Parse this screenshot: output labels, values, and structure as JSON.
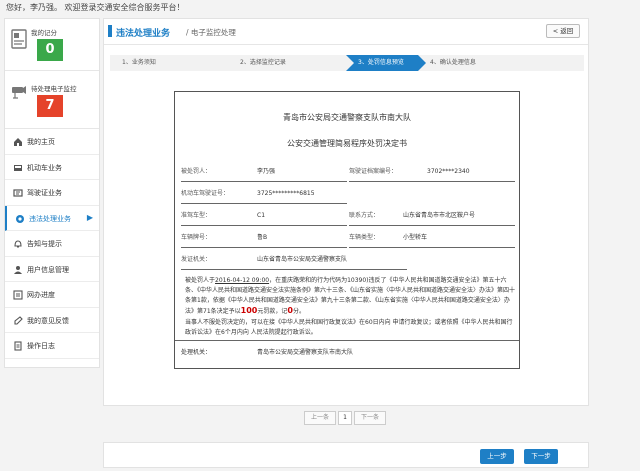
{
  "greeting": "您好，李乃强。 欢迎登录交通安全综合服务平台！",
  "sidebar": {
    "cards": [
      {
        "label": "我的记分",
        "count": "0",
        "color": "#3aa84a"
      },
      {
        "label": "待处理电子监控",
        "count": "7",
        "color": "#e5432a"
      }
    ],
    "items": [
      {
        "label": "我的主页",
        "icon": "home-icon"
      },
      {
        "label": "机动车业务",
        "icon": "car-icon"
      },
      {
        "label": "驾驶证业务",
        "icon": "license-icon"
      },
      {
        "label": "违法处理业务",
        "icon": "camera-icon",
        "active": true
      },
      {
        "label": "告知与提示",
        "icon": "bell-icon"
      },
      {
        "label": "用户信息管理",
        "icon": "user-icon"
      },
      {
        "label": "网办进度",
        "icon": "progress-icon"
      },
      {
        "label": "我的意见反馈",
        "icon": "feedback-icon"
      },
      {
        "label": "操作日志",
        "icon": "log-icon"
      }
    ]
  },
  "header": {
    "title": "违法处理业务",
    "subtitle": "/ 电子监控处理",
    "back_label": "< 返回"
  },
  "steps": [
    {
      "label": "1、业务须知"
    },
    {
      "label": "2、选择监控记录"
    },
    {
      "label": "3、处罚信息预览",
      "active": true
    },
    {
      "label": "4、确认处理信息"
    }
  ],
  "doc": {
    "org": "青岛市公安局交通警察支队市南大队",
    "title": "公安交通管理简易程序处罚决定书",
    "fields": {
      "name_k": "被处罚人：",
      "name_v": "李乃强",
      "lic_k": "驾驶证档案编号：",
      "lic_v": "3702****2340",
      "dl_k": "机动车驾驶证号：",
      "dl_v": "3725*********6815",
      "type_k": "准驾车型：",
      "type_v": "C1",
      "contact_k": "联系方式：",
      "contact_v": "山东省青岛市市北区鞍户号",
      "plate_k": "车辆牌号：",
      "plate_v": "鲁B",
      "vtype_k": "车辆类型：",
      "vtype_v": "小型轿车",
      "issuer_k": "发证机关：",
      "issuer_v": "山东省青岛市公安局交通警察支队"
    },
    "body": {
      "p1a": "被处罚人于",
      "p1_date": "2016-04-12 09:00",
      "p1b": "，在重庆路荣和的行为代码为10390)违反了《中华人民共和国道路交通安全法》第五十六条、《中华人民共和国道路交通安全法实施条例》第六十三条、《山东省实施〈中华人民共和国道路交通安全法〉办法》第四十条第1款，依据《中华人民共和国道路交通安全法》第九十三条第二款、《山东省实施〈中华人民共和国道路交通安全法〉办法》第71条决定予以",
      "fine": "100",
      "p1c": "元罚款，记",
      "points": "0",
      "p1d": "分。",
      "p2": "当事人不服处罚决定的，可以在接《中华人民共和国行政复议法》在60日内向 申请行政复议；或者依照《中华人民共和国行政诉讼法》在6个月内向 人民法院提起行政诉讼。"
    },
    "sign_k": "处理机关：",
    "sign_v": "青岛市公安局交通警察支队市南大队"
  },
  "pager": {
    "prev": "上一条",
    "page": "1",
    "next": "下一条"
  },
  "footer": {
    "prev": "上一步",
    "next": "下一步"
  }
}
